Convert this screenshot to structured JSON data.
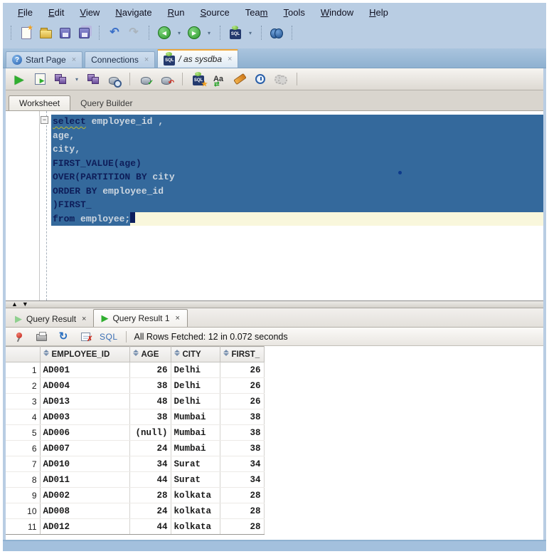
{
  "menu": {
    "items": [
      {
        "pre": "",
        "key": "F",
        "rest": "ile"
      },
      {
        "pre": "",
        "key": "E",
        "rest": "dit"
      },
      {
        "pre": "",
        "key": "V",
        "rest": "iew"
      },
      {
        "pre": "",
        "key": "N",
        "rest": "avigate"
      },
      {
        "pre": "",
        "key": "R",
        "rest": "un"
      },
      {
        "pre": "",
        "key": "S",
        "rest": "ource"
      },
      {
        "pre": "Tea",
        "key": "m",
        "rest": ""
      },
      {
        "pre": "",
        "key": "T",
        "rest": "ools"
      },
      {
        "pre": "",
        "key": "W",
        "rest": "indow"
      },
      {
        "pre": "",
        "key": "H",
        "rest": "elp"
      }
    ]
  },
  "icons": {
    "undo": "↶",
    "redo": "↷",
    "back": "◀",
    "forward": "▶",
    "caret": "▾",
    "run": "▶",
    "play": "▶",
    "close": "×",
    "question": "?",
    "refresh": "↻",
    "split_up": "▲",
    "split_down": "▼",
    "fold_minus": "−",
    "aa": "Aa"
  },
  "doc_tabs": {
    "start_page": "Start Page",
    "connections": "Connections",
    "sysdba": "/ as sysdba"
  },
  "editor_tabs": {
    "worksheet": "Worksheet",
    "query_builder": "Query Builder"
  },
  "code": {
    "lines": [
      {
        "segs": [
          {
            "text": "select",
            "role": "kw"
          },
          {
            "text": " employee_id ,",
            "role": "id"
          }
        ]
      },
      {
        "segs": [
          {
            "text": "age,",
            "role": "id"
          }
        ]
      },
      {
        "segs": [
          {
            "text": "city,",
            "role": "id"
          }
        ]
      },
      {
        "segs": [
          {
            "text": "FIRST_VALUE(age)",
            "role": "kw"
          }
        ]
      },
      {
        "segs": [
          {
            "text": "OVER(PARTITION BY",
            "role": "kw"
          },
          {
            "text": " city",
            "role": "id"
          }
        ]
      },
      {
        "segs": [
          {
            "text": "ORDER BY",
            "role": "kw"
          },
          {
            "text": " employee_id",
            "role": "id"
          }
        ]
      },
      {
        "segs": [
          {
            "text": ")FIRST_",
            "role": "kw"
          }
        ]
      },
      {
        "segs": [
          {
            "text": "from",
            "role": "kw"
          },
          {
            "text": " employee;",
            "role": "id"
          }
        ]
      }
    ]
  },
  "result_tabs": {
    "tab1": "Query Result",
    "tab2": "Query Result 1"
  },
  "results_toolbar": {
    "sql_label": "SQL",
    "status": "All Rows Fetched: 12 in 0.072 seconds"
  },
  "grid": {
    "columns": [
      "EMPLOYEE_ID",
      "AGE",
      "CITY",
      "FIRST_"
    ],
    "rows": [
      {
        "num": "1",
        "id": "AD001",
        "age": "26",
        "city": "Delhi",
        "first": "26"
      },
      {
        "num": "2",
        "id": "AD004",
        "age": "38",
        "city": "Delhi",
        "first": "26"
      },
      {
        "num": "3",
        "id": "AD013",
        "age": "48",
        "city": "Delhi",
        "first": "26"
      },
      {
        "num": "4",
        "id": "AD003",
        "age": "38",
        "city": "Mumbai",
        "first": "38"
      },
      {
        "num": "5",
        "id": "AD006",
        "age": "(null)",
        "city": "Mumbai",
        "first": "38"
      },
      {
        "num": "6",
        "id": "AD007",
        "age": "24",
        "city": "Mumbai",
        "first": "38"
      },
      {
        "num": "7",
        "id": "AD010",
        "age": "34",
        "city": "Surat",
        "first": "34"
      },
      {
        "num": "8",
        "id": "AD011",
        "age": "44",
        "city": "Surat",
        "first": "34"
      },
      {
        "num": "9",
        "id": "AD002",
        "age": "28",
        "city": "kolkata",
        "first": "28"
      },
      {
        "num": "10",
        "id": "AD008",
        "age": "24",
        "city": "kolkata",
        "first": "28"
      },
      {
        "num": "11",
        "id": "AD012",
        "age": "44",
        "city": "kolkata",
        "first": "28"
      }
    ]
  },
  "colors": {
    "frame": "#b9cde3",
    "selection": "#34699c",
    "keyword": "#0e1e5a",
    "identifier": "#ccd6e0",
    "current_line": "#f9f7dc",
    "active_tab_accent": "#eda63a"
  }
}
